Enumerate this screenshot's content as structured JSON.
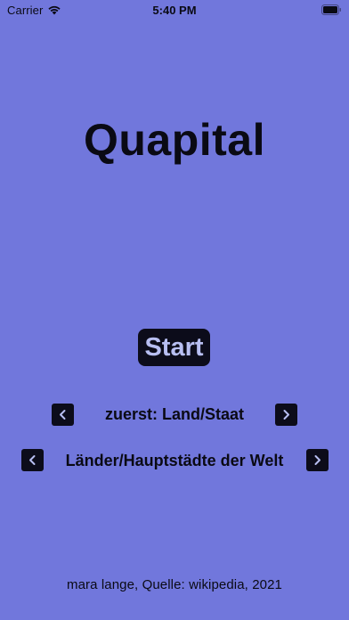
{
  "status_bar": {
    "carrier": "Carrier",
    "time": "5:40 PM",
    "wifi_icon": "wifi-icon",
    "battery_icon": "battery-icon"
  },
  "app": {
    "title": "Quapital",
    "start_label": "Start"
  },
  "options": {
    "direction": {
      "label": "zuerst: Land/Staat",
      "prev_icon": "chevron-left-icon",
      "next_icon": "chevron-right-icon"
    },
    "category": {
      "label": "Länder/Hauptstädte der Welt",
      "prev_icon": "chevron-left-icon",
      "next_icon": "chevron-right-icon"
    }
  },
  "footer": {
    "text": "mara lange,  Quelle: wikipedia,  2021"
  },
  "colors": {
    "background": "#7177dc",
    "button_background": "#0c0c1a",
    "button_text": "#b8bff2",
    "text": "#0a0a14"
  }
}
